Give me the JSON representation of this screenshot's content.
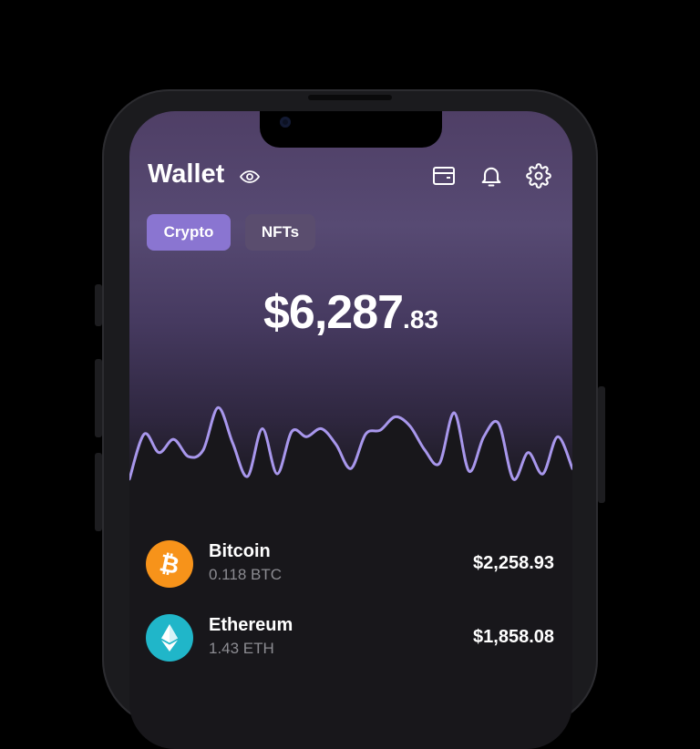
{
  "header": {
    "title": "Wallet",
    "icons": [
      "eye-icon",
      "wallet-card-icon",
      "bell-icon",
      "gear-icon"
    ]
  },
  "tabs": [
    {
      "label": "Crypto",
      "active": true
    },
    {
      "label": "NFTs",
      "active": false
    }
  ],
  "balance": {
    "main": "$6,287",
    "cents": ".83"
  },
  "chart_data": {
    "type": "area",
    "title": "",
    "xlabel": "",
    "ylabel": "",
    "y": [
      18,
      52,
      38,
      48,
      35,
      40,
      72,
      45,
      20,
      56,
      22,
      54,
      50,
      56,
      44,
      26,
      52,
      55,
      65,
      58,
      40,
      30,
      68,
      24,
      50,
      60,
      18,
      38,
      22,
      50,
      26
    ],
    "ylim": [
      0,
      110
    ],
    "grid": false,
    "line_color": "#a897ec",
    "fill_color": "#18171b"
  },
  "assets": [
    {
      "name": "Bitcoin",
      "amount": "0.118 BTC",
      "value": "$2,258.93",
      "icon": "bitcoin-icon",
      "color": "#f7931a"
    },
    {
      "name": "Ethereum",
      "amount": "1.43 ETH",
      "value": "$1,858.08",
      "icon": "ethereum-icon",
      "color": "#20b6c9"
    }
  ],
  "colors": {
    "accent": "#8a75d1",
    "tab_inactive": "#5a4d6e",
    "background": "#000000"
  }
}
